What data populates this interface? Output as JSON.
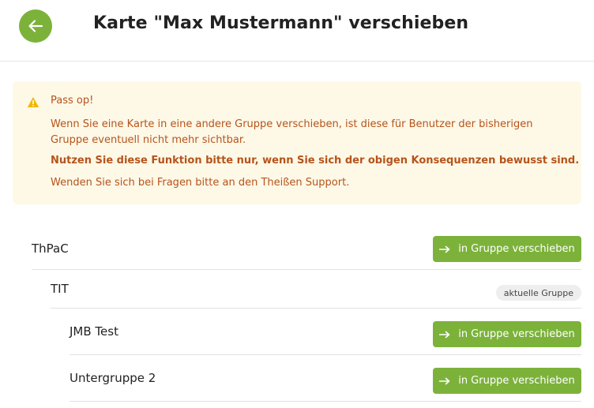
{
  "header": {
    "title": "Karte \"Max Mustermann\" verschieben",
    "back_icon": "arrow-left-icon"
  },
  "warning": {
    "icon": "warning-triangle-icon",
    "title": "Pass op!",
    "text": "Wenn Sie eine Karte in eine andere Gruppe verschieben, ist diese für Benutzer der bisherigen Gruppe eventuell nicht mehr sichtbar.",
    "bold_text": "Nutzen Sie diese Funktion bitte nur, wenn Sie sich der obigen Konsequenzen bewusst sind.",
    "support_text": "Wenden Sie sich bei Fragen bitte an den Theißen Support."
  },
  "groups": [
    {
      "name": "ThPaC",
      "action_label": "in Gruppe verschieben"
    },
    {
      "name": "TIT",
      "badge_label": "aktuelle Gruppe"
    },
    {
      "name": "JMB Test",
      "action_label": "in Gruppe verschieben"
    },
    {
      "name": "Untergruppe 2",
      "action_label": "in Gruppe verschieben"
    }
  ],
  "colors": {
    "accent": "#7cb23a",
    "warning_bg": "#fef8e7",
    "warning_text": "#b5541b",
    "warning_icon": "#f2b705"
  }
}
